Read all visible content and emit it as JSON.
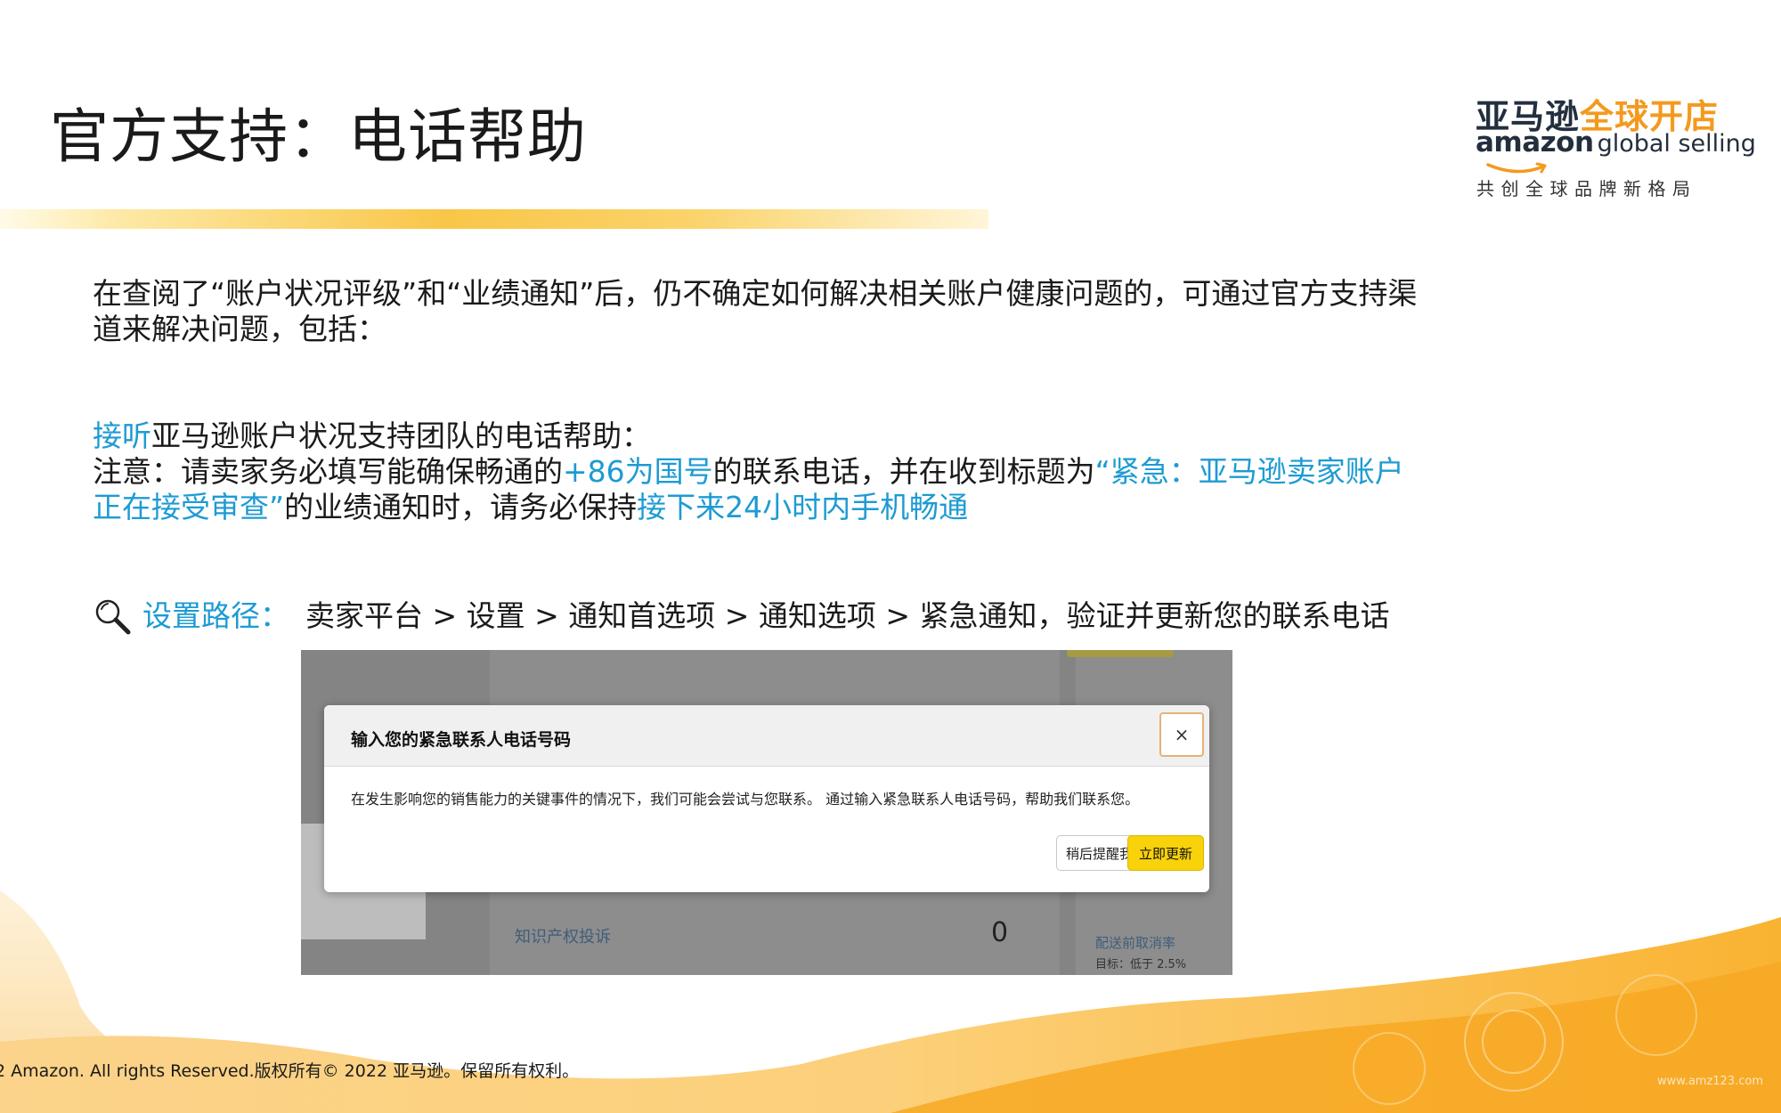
{
  "slide": {
    "title": "官方支持：电话帮助"
  },
  "logo": {
    "cn_dark": "亚马逊",
    "cn_orange": "全球开店",
    "brand": "amazon",
    "brand_suffix": "global selling",
    "slogan": "共创全球品牌新格局"
  },
  "intro": {
    "text": "在查阅了“账户状况评级”和“业绩通知”后，仍不确定如何解决相关账户健康问题的，可通过官方支持渠道来解决问题，包括："
  },
  "phone_help": {
    "line1_highlight": "接听",
    "line1_rest": "亚马逊账户状况支持团队的电话帮助：",
    "note_a": "注意：请卖家务必填写能确保畅通的",
    "note_b": "+86为国号",
    "note_c": "的联系电话，并在收到标题为",
    "note_d": "“紧急：亚马逊卖家账户正在接受审查”",
    "note_e": "的业绩通知时，请务必保持",
    "note_f": "接下来24小时内手机畅通"
  },
  "path": {
    "label": "设置路径：",
    "value": "卖家平台 > 设置 > 通知首选项 > 通知选项 > 紧急通知，验证并更新您的联系电话",
    "icon": "search-icon"
  },
  "screenshot": {
    "modal_title": "输入您的紧急联系人电话号码",
    "close_label": "×",
    "body": "在发生影响您的销售能力的关键事件的情况下，我们可能会尝试与您联系。 通过输入紧急联系人电话号码，帮助我们联系您。",
    "later_button": "稍后提醒我",
    "update_button": "立即更新",
    "bg_ip_label": "知识产权投诉",
    "bg_ip_value": "0",
    "bg_cancel_label": "配送前取消率",
    "bg_cancel_target": "目标：低于 2.5%"
  },
  "footer": {
    "copyright": "2 Amazon. All rights Reserved.版权所有© 2022 亚马逊。保留所有权利。",
    "watermark": "www.amz123.com"
  },
  "colors": {
    "accent_blue": "#1d9bd3",
    "brand_orange": "#f39a1e",
    "button_yellow": "#f8d20a"
  }
}
